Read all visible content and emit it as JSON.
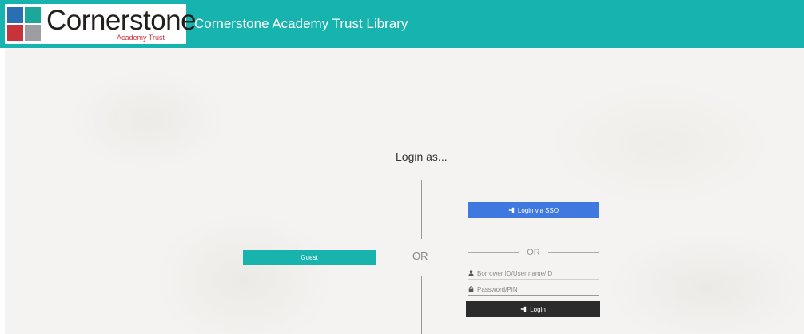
{
  "header": {
    "logo_text": "Cornerstone",
    "logo_subtext": "Academy Trust",
    "site_title": "Cornerstone Academy Trust Library",
    "bg_color": "#17b3ae"
  },
  "login": {
    "heading": "Login as...",
    "or_center": "OR",
    "guest_label": "Guest",
    "sso_label": "Login via SSO",
    "or_right": "OR",
    "username_placeholder": "Borrower ID/User name/ID",
    "password_placeholder": "Password/PIN",
    "login_label": "Login"
  },
  "icons": {
    "sso": "sign-in-icon",
    "login": "sign-in-icon",
    "user": "user-icon",
    "password": "lock-icon"
  },
  "colors": {
    "guest": "#18b3ad",
    "sso": "#3f79e0",
    "login": "#2b2b2b"
  }
}
